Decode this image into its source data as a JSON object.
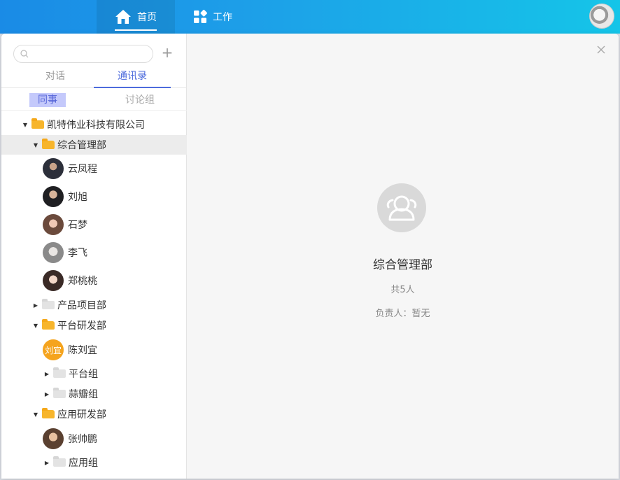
{
  "topbar": {
    "nav": [
      {
        "label": "首页",
        "icon": "home-icon"
      },
      {
        "label": "工作",
        "icon": "apps-icon"
      }
    ]
  },
  "sidebar": {
    "search": {
      "placeholder": ""
    },
    "tabs": [
      {
        "label": "对话"
      },
      {
        "label": "通讯录",
        "active": true
      }
    ],
    "subtabs": [
      {
        "label": "同事",
        "active": true
      },
      {
        "label": "讨论组"
      }
    ],
    "tree": {
      "company": "凯特伟业科技有限公司",
      "depts": [
        {
          "name": "综合管理部",
          "members": [
            "云凤程",
            "刘旭",
            "石梦",
            "李飞",
            "郑桃桃"
          ]
        },
        {
          "name": "产品项目部"
        },
        {
          "name": "平台研发部",
          "members": [
            {
              "name": "陈刘宜",
              "avatar_text": "刘宜"
            }
          ],
          "subgroups": [
            "平台组",
            "蒜瓣组"
          ]
        },
        {
          "name": "应用研发部",
          "members": [
            "张帅鹏"
          ],
          "subgroups": [
            "应用组"
          ]
        }
      ]
    }
  },
  "detail": {
    "title": "综合管理部",
    "count": "共5人",
    "owner": "负责人：暂无"
  },
  "colors": {
    "accent": "#4d6bdc",
    "folder": "#f7b52c",
    "topbar_start": "#1a8be6",
    "topbar_end": "#15c5e8"
  }
}
